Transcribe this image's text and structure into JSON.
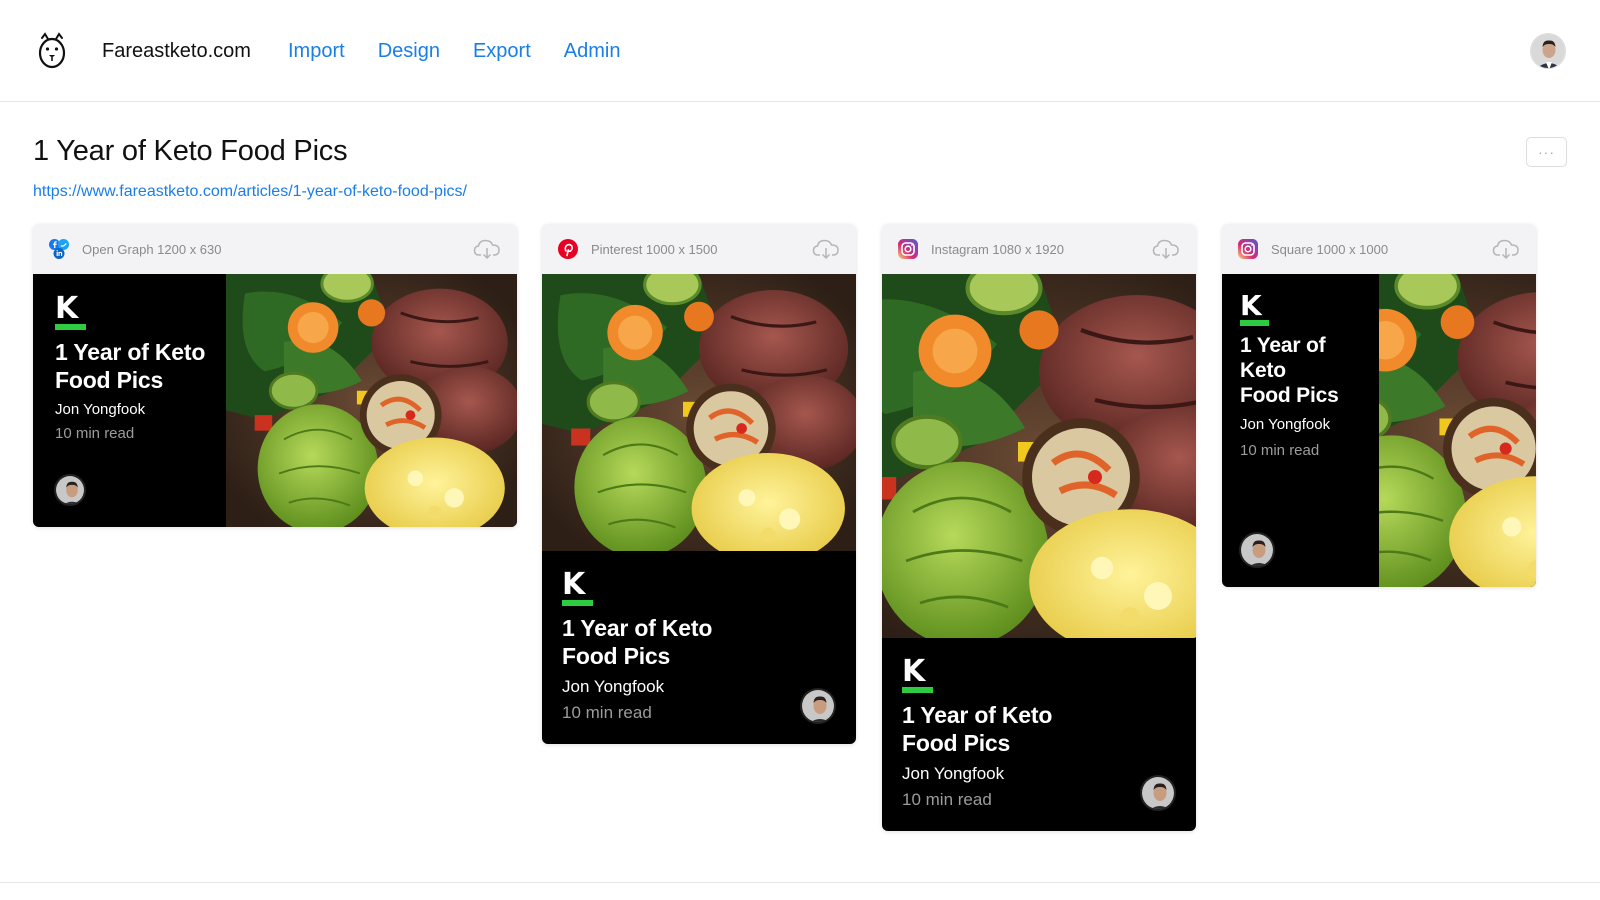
{
  "header": {
    "site_name": "Fareastketo.com",
    "nav": [
      "Import",
      "Design",
      "Export",
      "Admin"
    ]
  },
  "page": {
    "title": "1 Year of Keto Food Pics",
    "url": "https://www.fareastketo.com/articles/1-year-of-keto-food-pics/",
    "more_label": "···"
  },
  "article": {
    "brand_letter": "K",
    "title": "1 Year of Keto Food Pics",
    "title_lines_wide": [
      "1 Year of Keto",
      "Food Pics"
    ],
    "title_lines_narrow": [
      "1 Year of",
      "Keto",
      "Food Pics"
    ],
    "author": "Jon Yongfook",
    "read_time": "10 min read"
  },
  "cards": [
    {
      "format": "Open Graph 1200 x 630",
      "icon": "social-combo-icon"
    },
    {
      "format": "Pinterest 1000 x 1500",
      "icon": "pinterest-icon"
    },
    {
      "format": "Instagram 1080 x 1920",
      "icon": "instagram-icon"
    },
    {
      "format": "Square 1000 x 1000",
      "icon": "instagram-icon"
    }
  ],
  "colors": {
    "accent": "#1a7ee8",
    "brand_green": "#2ecc40",
    "card_bg": "#000000",
    "pinterest": "#e60023"
  }
}
